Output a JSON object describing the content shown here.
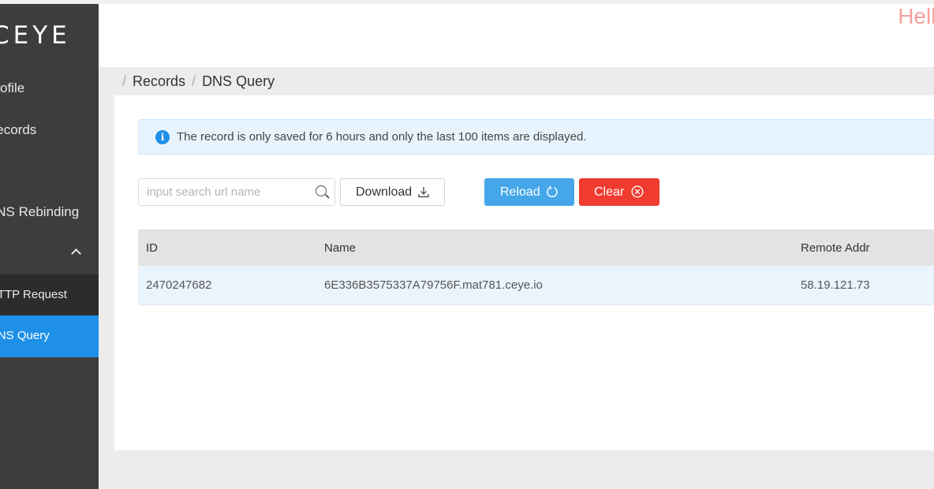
{
  "sidebar": {
    "logo": "CEYE",
    "items": [
      {
        "label": "Profile"
      },
      {
        "label": "Records"
      },
      {
        "label": "DNS Rebinding"
      }
    ],
    "submenu": [
      {
        "label": "HTTP Request"
      },
      {
        "label": "DNS Query"
      }
    ]
  },
  "header": {
    "corner_text": "Hello"
  },
  "breadcrumb": {
    "items": [
      "Records",
      "DNS Query"
    ]
  },
  "alert": {
    "icon": "info-icon",
    "message": "The record is only saved for 6 hours and only the last 100 items are displayed."
  },
  "toolbar": {
    "search_placeholder": "input search url name",
    "search_value": "",
    "download_label": "Download",
    "reload_label": "Reload",
    "clear_label": "Clear"
  },
  "table": {
    "columns": [
      "ID",
      "Name",
      "Remote Addr"
    ],
    "rows": [
      {
        "id": "2470247682",
        "name": "6E336B3575337A79756F.mat781.ceye.io",
        "remote_addr": "58.19.121.73"
      }
    ]
  },
  "colors": {
    "sidebar_bg": "#3d3d3d",
    "active_menu": "#1e90e8",
    "reload_button": "#45a7ea",
    "clear_button": "#f03c30",
    "alert_bg": "#e8f4fd"
  }
}
